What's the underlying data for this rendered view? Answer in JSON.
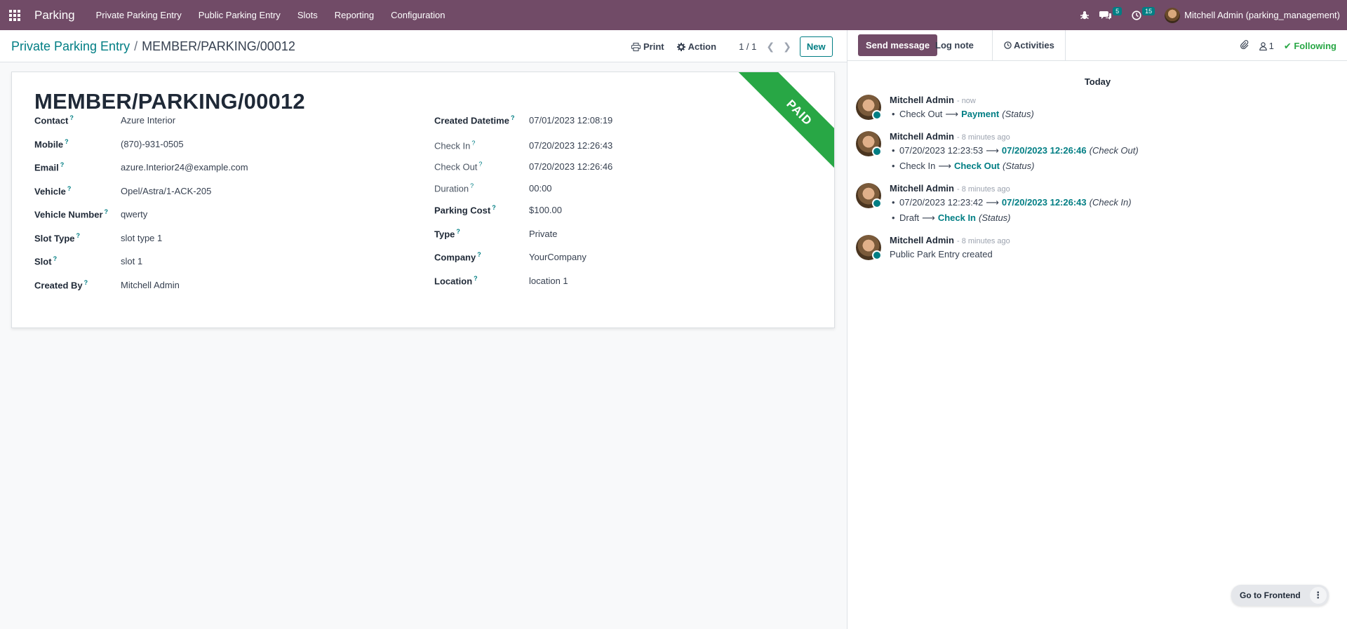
{
  "navbar": {
    "brand": "Parking",
    "menu": [
      "Private Parking Entry",
      "Public Parking Entry",
      "Slots",
      "Reporting",
      "Configuration"
    ],
    "messages_count": "5",
    "activities_count": "15",
    "user": "Mitchell Admin (parking_management)"
  },
  "control_panel": {
    "breadcrumb_parent": "Private Parking Entry",
    "breadcrumb_separator": "/",
    "breadcrumb_current": "MEMBER/PARKING/00012",
    "print_label": "Print",
    "action_label": "Action",
    "pager": "1 / 1",
    "new_label": "New"
  },
  "form": {
    "title": "MEMBER/PARKING/00012",
    "ribbon": "PAID",
    "help_mark": "?",
    "left_fields": [
      {
        "label": "Contact",
        "value": "Azure Interior"
      },
      {
        "label": "Mobile",
        "value": "(870)-931-0505"
      },
      {
        "label": "Email",
        "value": "azure.Interior24@example.com"
      },
      {
        "label": "Vehicle",
        "value": "Opel/Astra/1-ACK-205"
      },
      {
        "label": "Vehicle Number",
        "value": "qwerty"
      },
      {
        "label": "Slot Type",
        "value": "slot type 1"
      },
      {
        "label": "Slot",
        "value": "slot 1"
      },
      {
        "label": "Created By",
        "value": "Mitchell Admin"
      }
    ],
    "right_fields": [
      {
        "label": "Created Datetime",
        "value": "07/01/2023 12:08:19"
      },
      {
        "label": "Check In",
        "value": "07/20/2023 12:26:43"
      },
      {
        "label": "Check Out",
        "value": "07/20/2023 12:26:46"
      },
      {
        "label": "Duration",
        "value": "00:00"
      },
      {
        "label": "Parking Cost",
        "value": "$100.00"
      },
      {
        "label": "Type",
        "value": "Private"
      },
      {
        "label": "Company",
        "value": "YourCompany"
      },
      {
        "label": "Location",
        "value": "location 1"
      }
    ]
  },
  "chatter": {
    "send_message": "Send message",
    "log_note": "Log note",
    "activities": "Activities",
    "followers_count": "1",
    "following": "Following",
    "day_separator": "Today",
    "arrow": "⟶",
    "messages": [
      {
        "author": "Mitchell Admin",
        "date": "- now",
        "changes": [
          {
            "old": "Check Out",
            "new": "Payment",
            "field": "(Status)"
          }
        ]
      },
      {
        "author": "Mitchell Admin",
        "date": "- 8 minutes ago",
        "changes": [
          {
            "old": "07/20/2023 12:23:53",
            "new": "07/20/2023 12:26:46",
            "field": "(Check Out)"
          },
          {
            "old": "Check In",
            "new": "Check Out",
            "field": "(Status)"
          }
        ]
      },
      {
        "author": "Mitchell Admin",
        "date": "- 8 minutes ago",
        "changes": [
          {
            "old": "07/20/2023 12:23:42",
            "new": "07/20/2023 12:26:43",
            "field": "(Check In)"
          },
          {
            "old": "Draft",
            "new": "Check In",
            "field": "(Status)"
          }
        ]
      },
      {
        "author": "Mitchell Admin",
        "date": "- 8 minutes ago",
        "body": "Public Park Entry created"
      }
    ]
  },
  "frontend_button": "Go to Frontend",
  "colors": {
    "brand": "#714B67",
    "accent": "#017e84",
    "paid": "#28a745"
  }
}
